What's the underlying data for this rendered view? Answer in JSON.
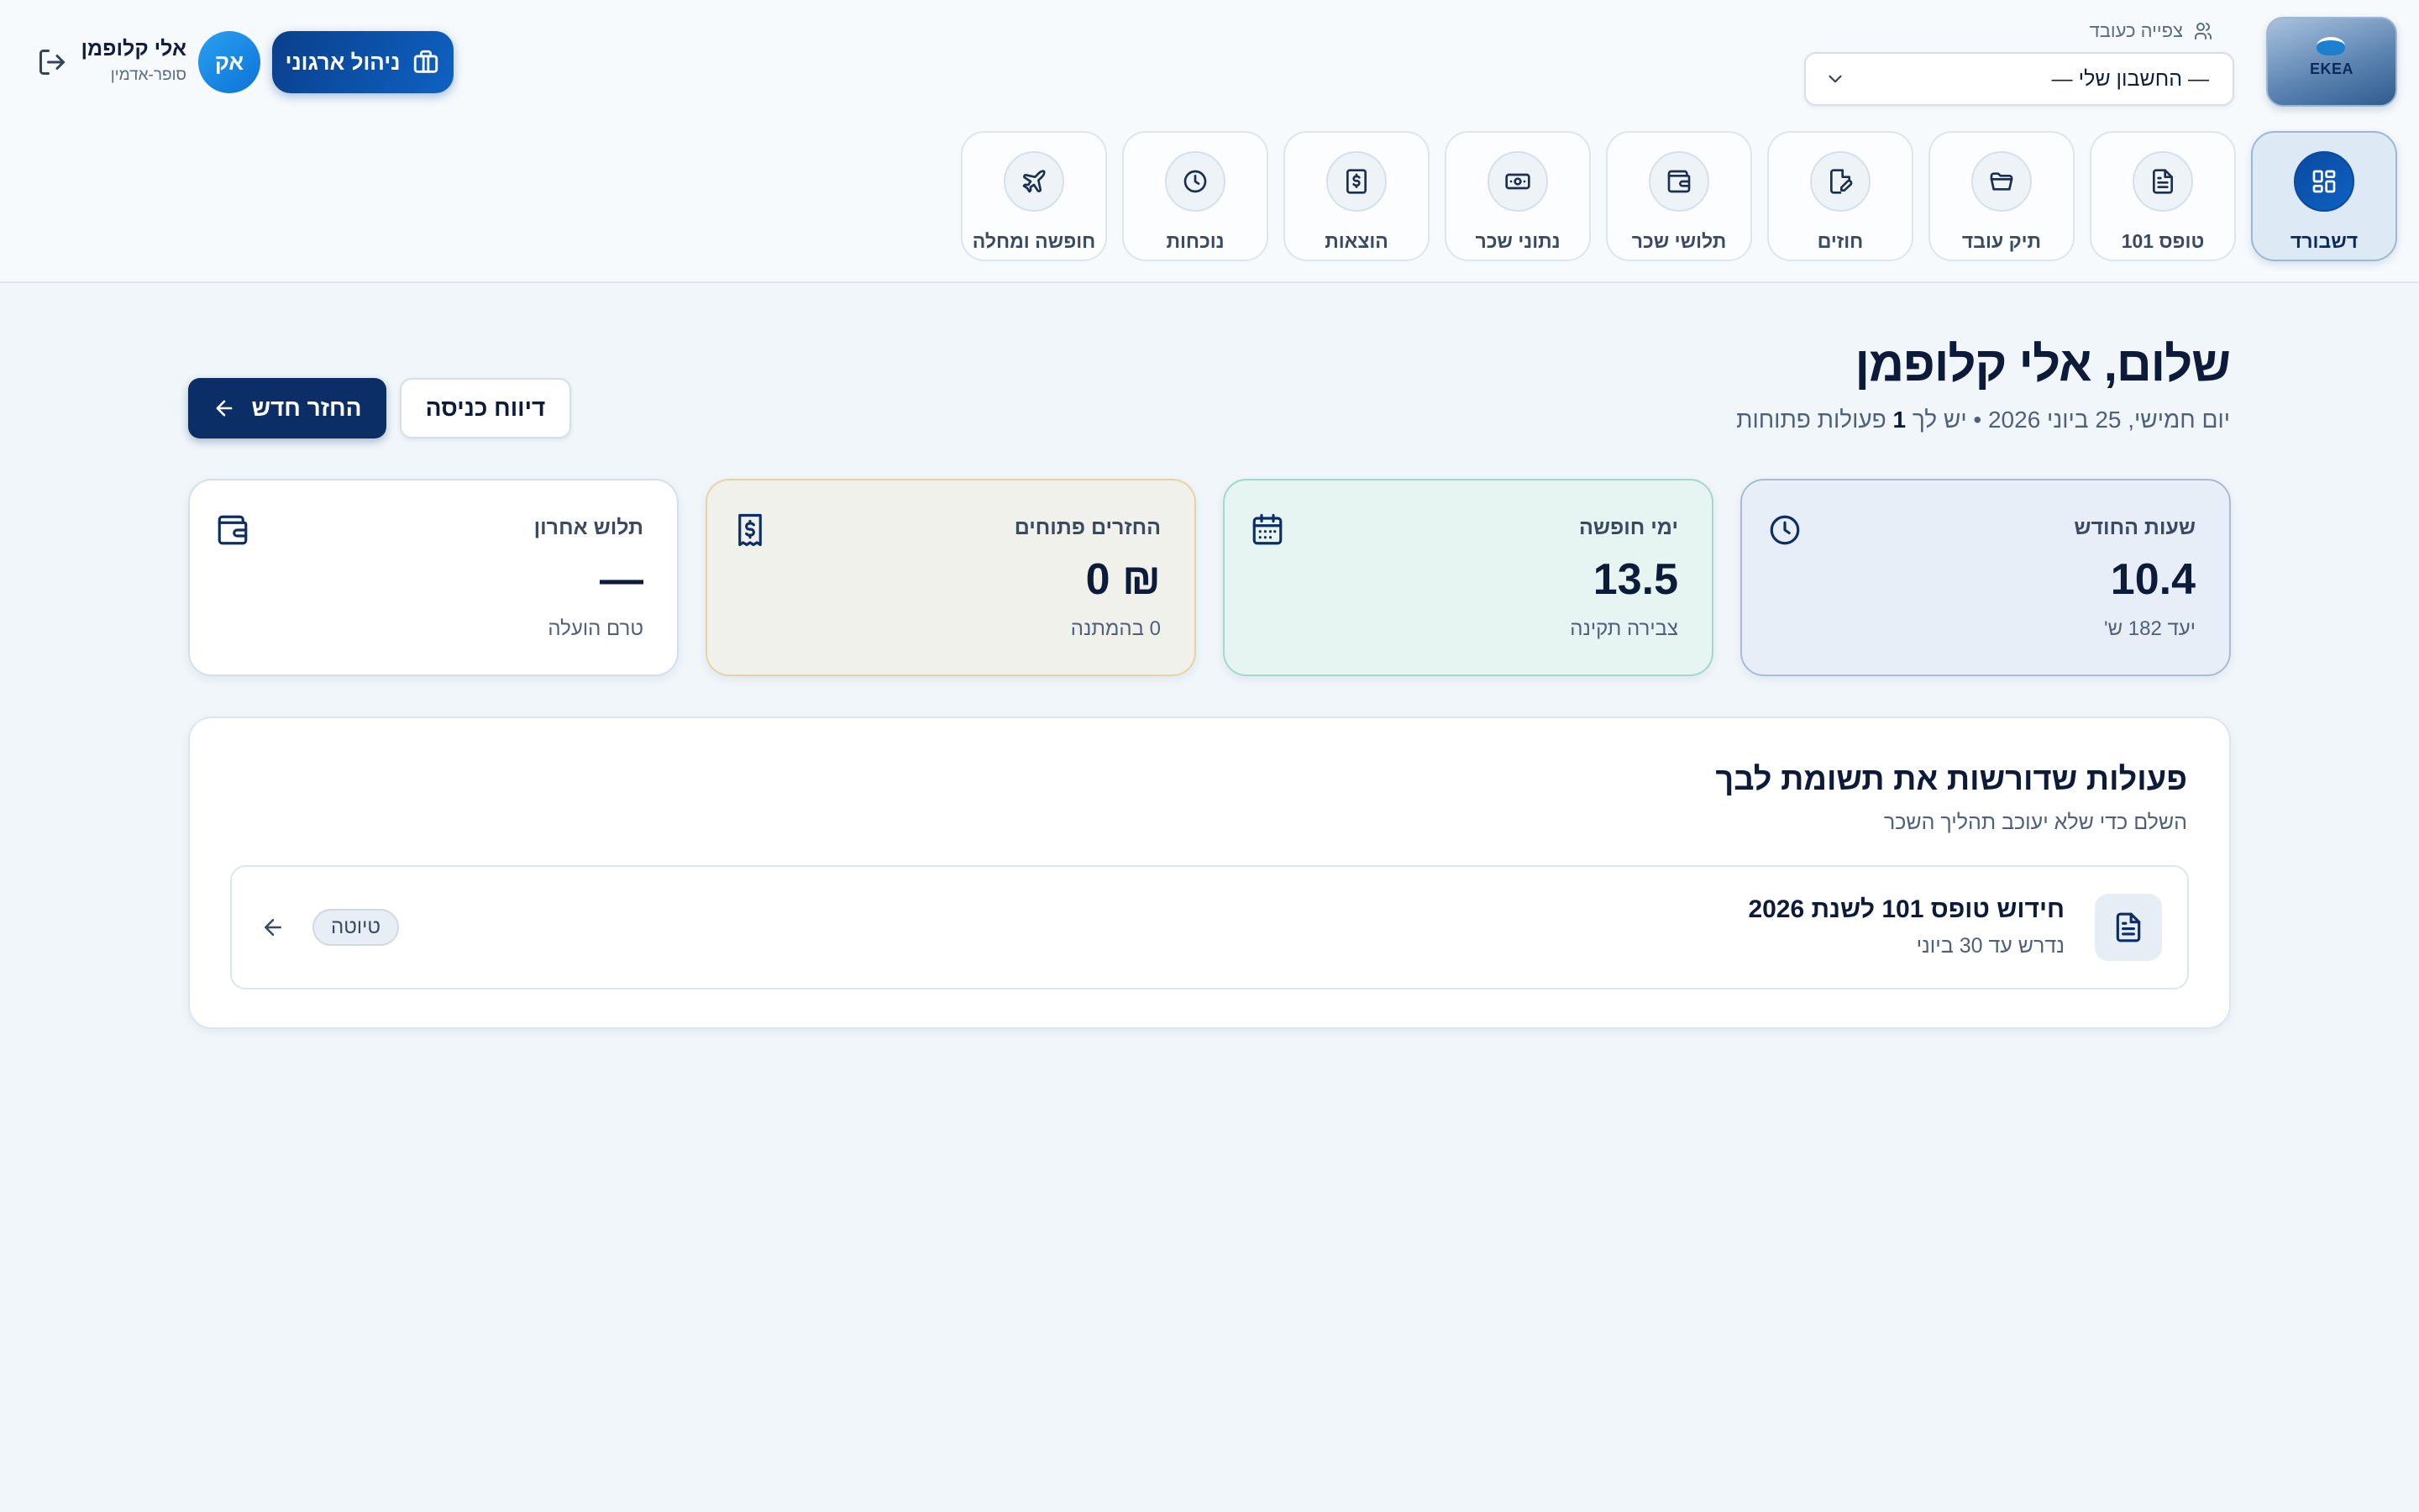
{
  "header": {
    "logo_text": "EKEA",
    "view_as_label": "צפייה כעובד",
    "account_select_value": "— החשבון שלי —",
    "user": {
      "name": "אלי קלופמן",
      "role": "סופר-אדמין",
      "initials": "אק"
    },
    "org_button_label": "ניהול ארגוני"
  },
  "nav": [
    {
      "label": "דשבורד",
      "icon": "dashboard-icon",
      "active": true
    },
    {
      "label": "טופס 101",
      "icon": "document-icon",
      "active": false
    },
    {
      "label": "תיק עובד",
      "icon": "folder-icon",
      "active": false
    },
    {
      "label": "חוזים",
      "icon": "contract-icon",
      "active": false
    },
    {
      "label": "תלושי שכר",
      "icon": "wallet-icon",
      "active": false
    },
    {
      "label": "נתוני שכר",
      "icon": "cash-icon",
      "active": false
    },
    {
      "label": "הוצאות",
      "icon": "dollar-receipt-icon",
      "active": false
    },
    {
      "label": "נוכחות",
      "icon": "clock-icon",
      "active": false
    },
    {
      "label": "חופשה ומחלה",
      "icon": "plane-icon",
      "active": false
    }
  ],
  "greeting": {
    "title": "שלום, אלי קלופמן",
    "subtitle_pre": "יום חמישי, 25 ביוני 2026 • יש לך ",
    "subtitle_count": "1",
    "subtitle_post": " פעולות פתוחות"
  },
  "buttons": {
    "new_refund": "החזר חדש",
    "entry_report": "דיווח כניסה"
  },
  "stats": [
    {
      "title": "שעות החודש",
      "value": "10.4",
      "sub": "יעד 182 ש'",
      "icon": "clock-icon"
    },
    {
      "title": "ימי חופשה",
      "value": "13.5",
      "sub": "צבירה תקינה",
      "icon": "calendar-icon"
    },
    {
      "title": "החזרים פתוחים",
      "value": "₪ 0",
      "sub": "0 בהמתנה",
      "icon": "receipt-icon"
    },
    {
      "title": "תלוש אחרון",
      "value": "—",
      "sub": "טרם הועלה",
      "icon": "wallet-icon"
    }
  ],
  "actions_panel": {
    "title": "פעולות שדורשות את תשומת לבך",
    "subtitle": "השלם כדי שלא יעוכב תהליך השכר",
    "items": [
      {
        "title": "חידוש טופס 101 לשנת 2026",
        "sub": "נדרש עד 30 ביוני",
        "badge": "טיוטה"
      }
    ]
  },
  "colors": {
    "primary": "#0b2e66",
    "accent": "#0e62c4",
    "background": "#f0f6fa"
  }
}
